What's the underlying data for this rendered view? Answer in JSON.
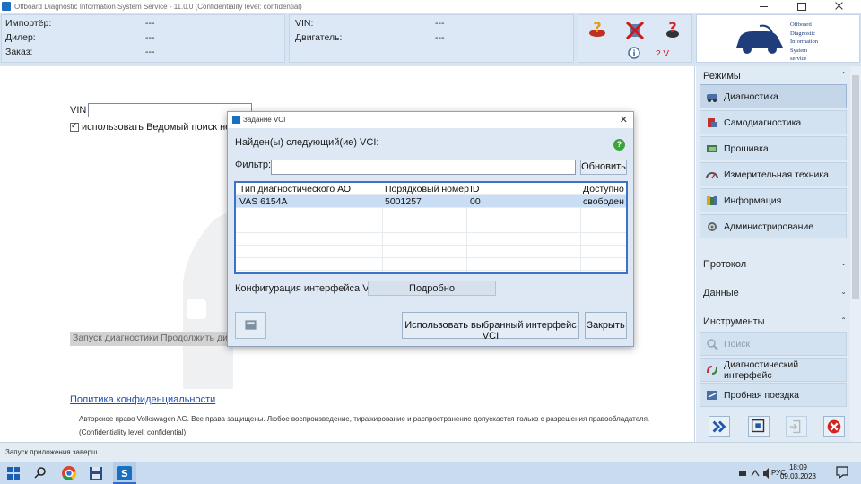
{
  "window": {
    "title": "Offboard Diagnostic Information System Service - 11.0.0 (Confidentiality level: confidential)"
  },
  "header": {
    "importer_label": "Импортёр:",
    "importer_value": "---",
    "dealer_label": "Дилер:",
    "dealer_value": "---",
    "order_label": "Заказ:",
    "order_value": "---",
    "vin_label": "VIN:",
    "vin_value": "---",
    "engine_label": "Двигатель:",
    "engine_value": "---",
    "version_label": "? V",
    "logo_lines": [
      "Offboard",
      "Diagnostic",
      "Information",
      "System",
      "service"
    ]
  },
  "main": {
    "vin_label": "VIN",
    "use_guided_search": "использовать Ведомый поиск неиспр",
    "start_diag": "Запуск диагностики",
    "continue_diag": "Продолжить диа",
    "privacy": "Политика конфиденциальности",
    "copyright": "Авторское право Volkswagen AG. Все права защищены. Любое воспроизведение, тиражирование и распространение допускается только с разрешения правообладателя.",
    "confidentiality": "(Confidentiality level: confidential)"
  },
  "sidebar": {
    "modes_title": "Режимы",
    "modes": [
      "Диагностика",
      "Самодиагностика",
      "Прошивка",
      "Измерительная техника",
      "Информация",
      "Администрирование"
    ],
    "protocol_title": "Протокол",
    "data_title": "Данные",
    "tools_title": "Инструменты",
    "tools": [
      "Поиск",
      "Диагностический интерфейс",
      "Пробная поездка"
    ]
  },
  "status": {
    "text": "Запуск приложения заверш."
  },
  "taskbar": {
    "lang": "РУС",
    "time": "18:09",
    "date": "09.03.2023"
  },
  "dialog": {
    "title": "Задание VCI",
    "found": "Найден(ы) следующий(ие) VCI:",
    "filter_label": "Фильтр:",
    "filter_value": "",
    "refresh": "Обновить",
    "columns": [
      "Тип диагностического АО",
      "Порядковый номер",
      "ID",
      "Доступно"
    ],
    "rows": [
      [
        "VAS 6154A",
        "5001257",
        "00",
        "свободен"
      ]
    ],
    "config_label": "Конфигурация интерфейса VCI",
    "details": "Подробно",
    "use_selected": "Использовать выбранный интерфейс VCI",
    "close": "Закрыть"
  },
  "colors": {
    "accent": "#3a73c7",
    "header_bg": "#d7e5f3",
    "sidebar_bg": "#dfeaf5",
    "link": "#1c4fb3"
  }
}
